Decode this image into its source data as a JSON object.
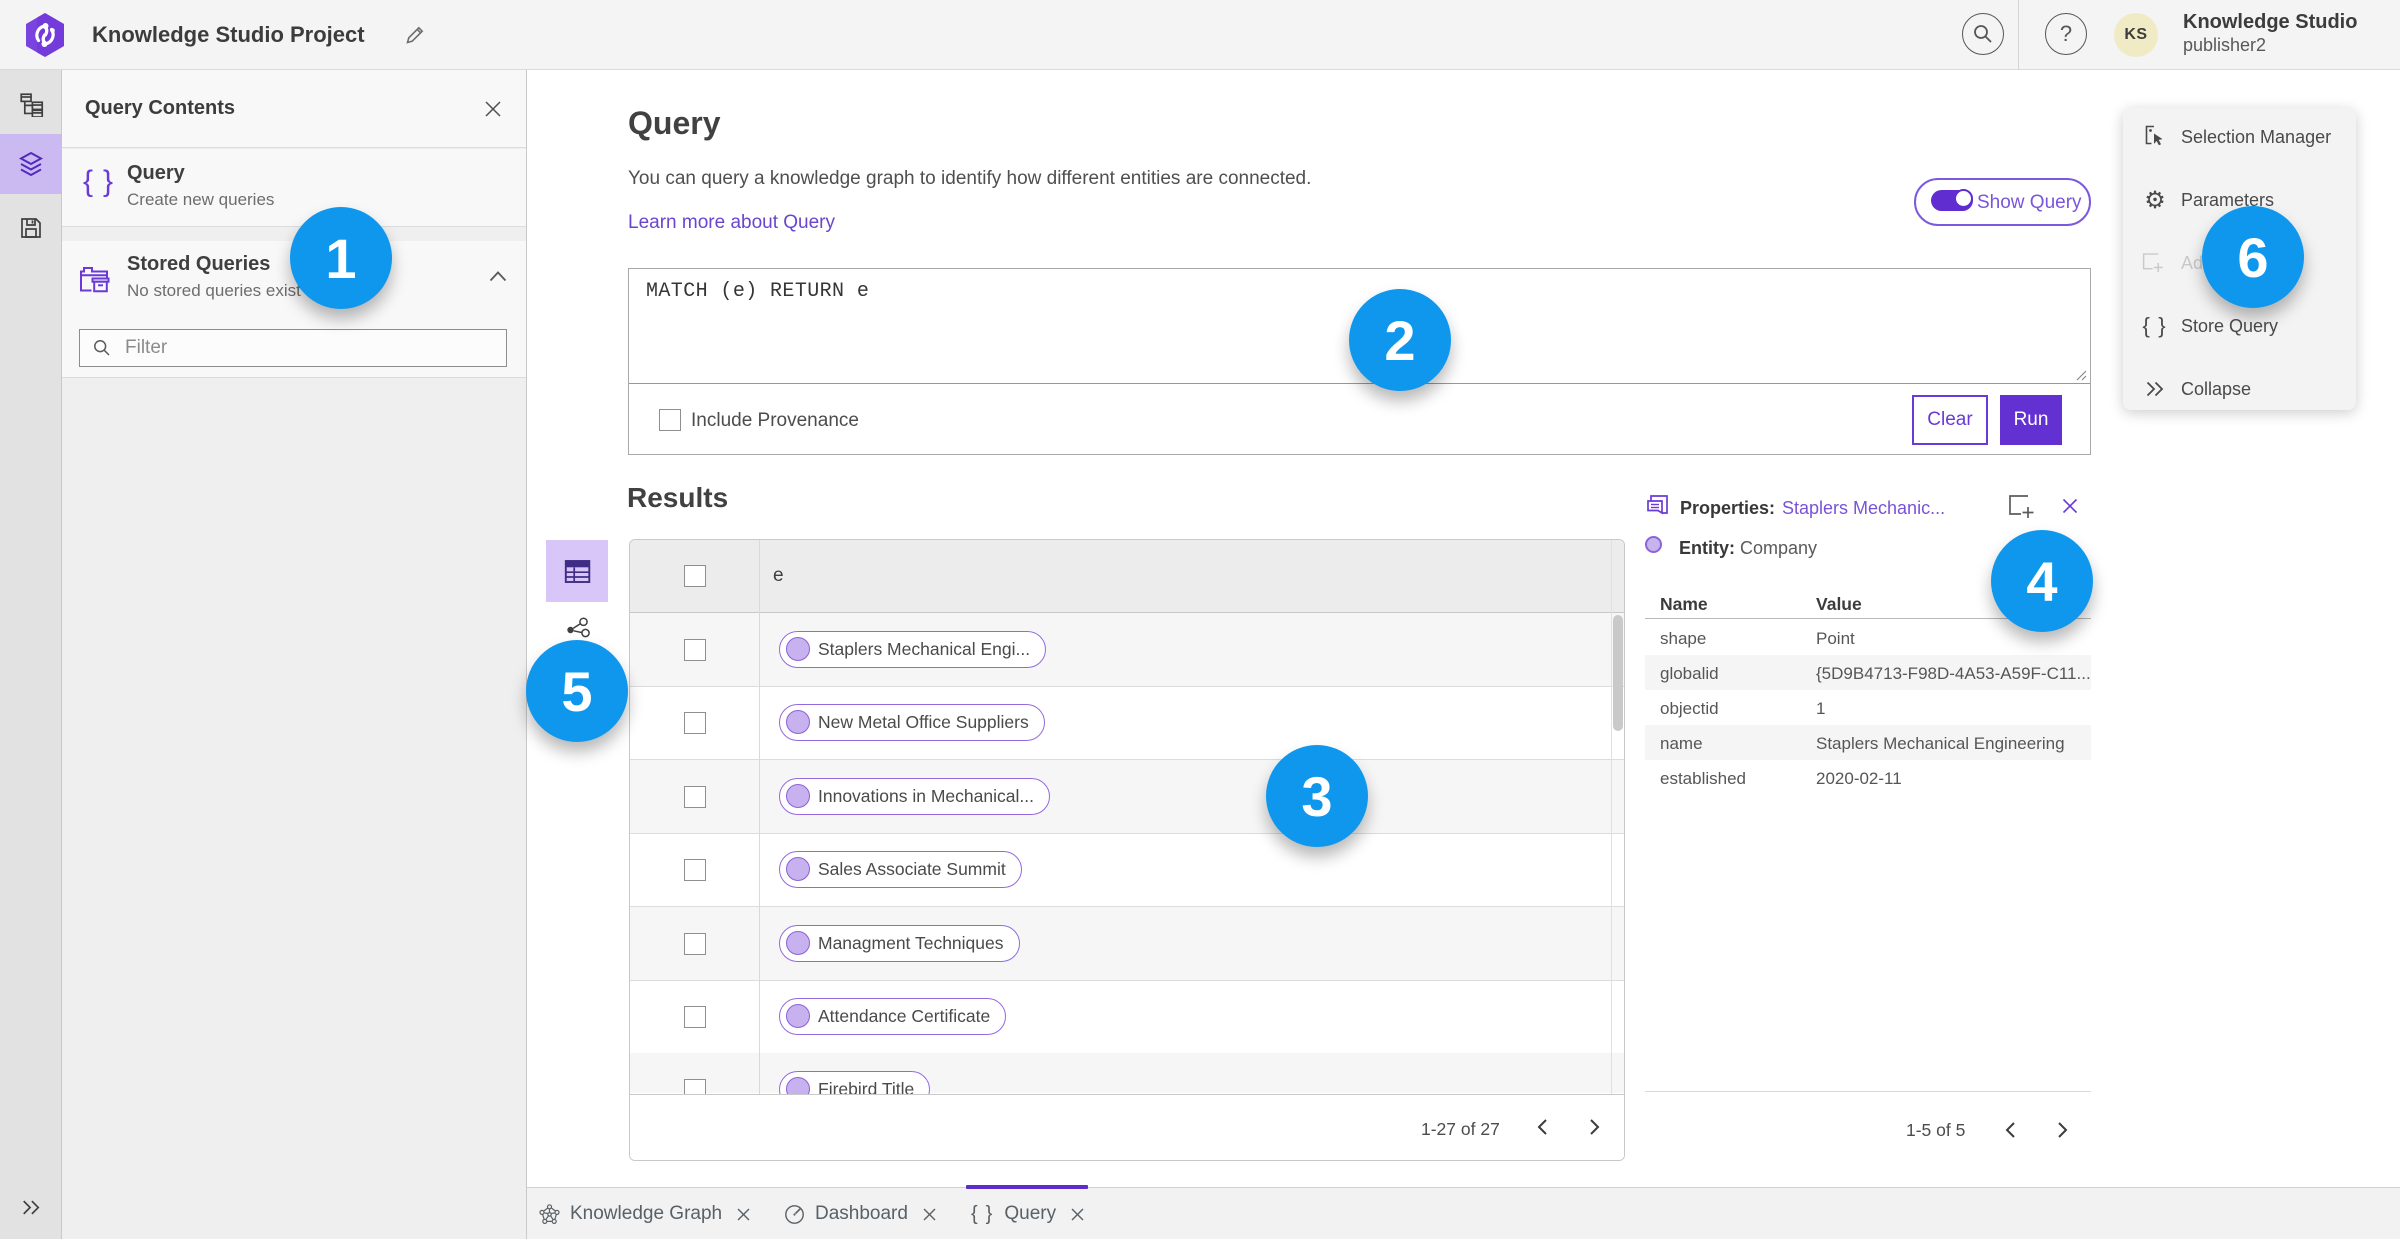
{
  "app": {
    "title": "Knowledge Studio Project"
  },
  "user": {
    "initials": "KS",
    "name": "Knowledge Studio",
    "role": "publisher2"
  },
  "colors": {
    "accent_purple": "#6331d2",
    "selected_purple_bg": "#cbbaf2",
    "badge_blue": "#1193e8",
    "link_purple": "#6a45cf"
  },
  "left_panel": {
    "title": "Query Contents",
    "query_item": {
      "label": "Query",
      "description": "Create new queries"
    },
    "stored_queries": {
      "label": "Stored Queries",
      "description": "No stored queries exist"
    },
    "filter_placeholder": "Filter"
  },
  "query_section": {
    "title": "Query",
    "description": "You can query a knowledge graph to identify how different entities are connected.",
    "learn_more": "Learn more about Query",
    "show_query_label": "Show Query",
    "show_query_on": true,
    "code": "MATCH (e) RETURN e",
    "include_provenance": "Include Provenance",
    "include_provenance_checked": false,
    "clear_label": "Clear",
    "run_label": "Run"
  },
  "results": {
    "title": "Results",
    "column_header": "e",
    "rows": [
      "Staplers Mechanical Engi...",
      "New Metal Office Suppliers",
      "Innovations in Mechanical...",
      "Sales Associate Summit",
      "Managment Techniques",
      "Attendance Certificate",
      "Firebird Title"
    ],
    "pagination": "1-27 of 27",
    "active_view": "table",
    "rows_selected": []
  },
  "properties": {
    "label": "Properties:",
    "link": "Staplers Mechanic...",
    "entity_label": "Entity:",
    "entity_value": "Company",
    "col_name": "Name",
    "col_value": "Value",
    "rows": [
      [
        "shape",
        "Point"
      ],
      [
        "globalid",
        "{5D9B4713-F98D-4A53-A59F-C11..."
      ],
      [
        "objectid",
        "1"
      ],
      [
        "name",
        "Staplers Mechanical Engineering"
      ],
      [
        "established",
        "2020-02-11"
      ]
    ],
    "pagination": "1-5 of 5"
  },
  "context_menu": {
    "items": [
      {
        "label": "Selection Manager",
        "icon": "selection-manager-icon",
        "disabled": false
      },
      {
        "label": "Parameters",
        "icon": "gear-icon",
        "disabled": false
      },
      {
        "label": "Add To Map",
        "icon": "add-to-map-icon",
        "disabled": true
      },
      {
        "label": "Store Query",
        "icon": "braces-icon",
        "disabled": false
      },
      {
        "label": "Collapse",
        "icon": "double-chevron-right-icon",
        "disabled": false
      }
    ]
  },
  "tabs": [
    {
      "label": "Knowledge Graph",
      "icon": "knowledge-graph-icon",
      "active": false
    },
    {
      "label": "Dashboard",
      "icon": "dashboard-gauge-icon",
      "active": false
    },
    {
      "label": "Query",
      "icon": "braces-icon",
      "active": true
    }
  ],
  "badges": [
    "1",
    "2",
    "3",
    "4",
    "5",
    "6"
  ],
  "icons": [
    "knowledge-studio-logo-icon",
    "edit-title-pencil-icon",
    "search-icon",
    "question-mark-icon",
    "data-model-hierarchy-icon",
    "layers-icon",
    "save-icon",
    "double-chevron-right-icon",
    "braces-icon",
    "stored-queries-folder-icon",
    "chevron-up-icon",
    "filter-search-icon",
    "close-icon",
    "toggle-icon",
    "resize-handle",
    "table-icon",
    "link-chart-icon",
    "entity-dot-icon",
    "chevron-left-icon",
    "chevron-right-icon",
    "properties-report-icon",
    "add-to-map-icon",
    "entity-type-icon",
    "selection-manager-icon",
    "gear-icon",
    "knowledge-graph-icon",
    "dashboard-gauge-icon"
  ]
}
